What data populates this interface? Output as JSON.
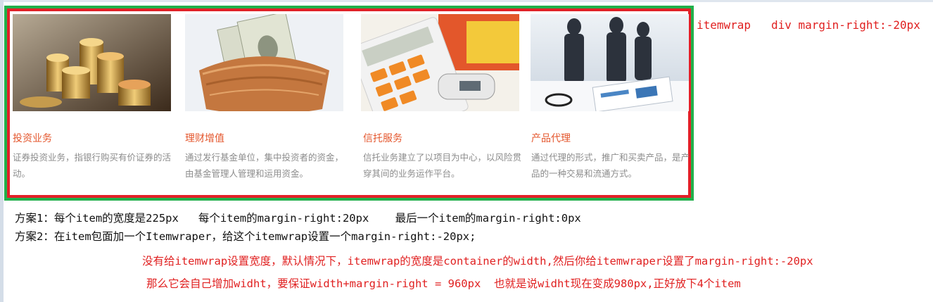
{
  "items": [
    {
      "title": "投资业务",
      "desc": "证券投资业务，指银行购买有价证券的活动。",
      "image": "gold-coins-photo"
    },
    {
      "title": "理财增值",
      "desc": "通过发行基金单位，集中投资者的资金，由基金管理人管理和运用资金。",
      "image": "dollar-nest-photo"
    },
    {
      "title": "信托服务",
      "desc": "信托业务建立了以项目为中心，以风险贯穿其间的业务运作平台。",
      "image": "calculator-cards-photo"
    },
    {
      "title": "产品代理",
      "desc": "通过代理的形式，推广和买卖产品，是产品的一种交易和流通方式。",
      "image": "business-handshake-photo"
    }
  ],
  "annotations": {
    "right_note": "itemwrap   div margin-right:-20px",
    "plan1": "方案1：每个item的宽度是225px   每个item的margin-right:20px    最后一个item的margin-right:0px",
    "plan2": "方案2：在item包面加一个Itemwraper，给这个itemwrap设置一个margin-right:-20px;",
    "red_line1": "没有给itemwrap设置宽度，默认情况下，itemwrap的宽度是container的width,然后你给itemwraper设置了margin-right:-20px",
    "red_line2": "那么它会自己增加widht，要保证width+margin-right = 960px  也就是说widht现在变成980px,正好放下4个item"
  },
  "colors": {
    "outer_border": "#21b04b",
    "inner_border": "#e32028",
    "title": "#e4572e",
    "desc": "#8c8c8c",
    "note_red": "#e02020"
  }
}
